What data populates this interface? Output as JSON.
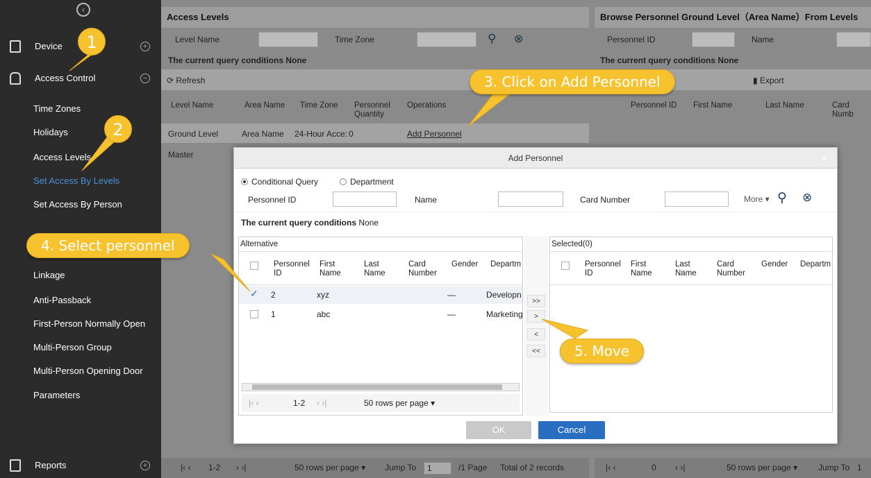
{
  "sidebar": {
    "modules": [
      {
        "label": "Device"
      },
      {
        "label": "Access Control"
      }
    ],
    "sub_items": [
      {
        "label": "Time Zones"
      },
      {
        "label": "Holidays"
      },
      {
        "label": "Access Levels"
      },
      {
        "label": "Set Access By Levels"
      },
      {
        "label": "Set Access By Person"
      },
      {
        "label": "Linkage"
      },
      {
        "label": "Anti-Passback"
      },
      {
        "label": "First-Person Normally Open"
      },
      {
        "label": "Multi-Person Group"
      },
      {
        "label": "Multi-Person Opening Door"
      },
      {
        "label": "Parameters"
      }
    ],
    "bottom_module": "Reports"
  },
  "left_panel": {
    "title": "Access Levels",
    "level_name_label": "Level Name",
    "time_zone_label": "Time Zone",
    "query_conditions": "The current query conditions None",
    "refresh_label": "Refresh",
    "columns": [
      "Level Name",
      "Area Name",
      "Time Zone",
      "Personnel Quantity",
      "Operations"
    ],
    "rows": [
      {
        "level": "Ground Level",
        "area": "Area Name",
        "tz": "24-Hour Acce:",
        "qty": "0",
        "op": "Add Personnel"
      },
      {
        "level": "Master",
        "area": "",
        "tz": "",
        "qty": "",
        "op": ""
      }
    ],
    "footer": {
      "page": "1-2",
      "rows_per_page": "50 rows per page",
      "jump_to": "Jump To",
      "jump_value": "1",
      "page_total": "/1 Page",
      "records": "Total of 2 records"
    }
  },
  "right_panel": {
    "title": "Browse Personnel Ground Level（Area Name）From Levels",
    "personnel_id_label": "Personnel ID",
    "name_label": "Name",
    "query_conditions": "The current query conditions None",
    "export_label": "Export",
    "columns": [
      "Personnel ID",
      "First Name",
      "Last Name",
      "Card Numb"
    ],
    "footer": {
      "page": "0",
      "rows_per_page": "50 rows per page",
      "jump_to": "Jump To",
      "jump_value": "1"
    }
  },
  "dialog": {
    "title": "Add Personnel",
    "close": "×",
    "mode_conditional": "Conditional Query",
    "mode_department": "Department",
    "personnel_id_label": "Personnel ID",
    "name_label": "Name",
    "card_number_label": "Card Number",
    "more_label": "More",
    "query_conditions_label": "The current query conditions",
    "query_conditions_value": "None",
    "alternative": {
      "title": "Alternative",
      "columns": [
        "Personnel ID",
        "First Name",
        "Last Name",
        "Card Number",
        "Gender",
        "Departm"
      ],
      "rows": [
        {
          "id": "2",
          "first": "xyz",
          "last": "",
          "card": "",
          "gender": "—",
          "dept": "Developn",
          "checked": true
        },
        {
          "id": "1",
          "first": "abc",
          "last": "",
          "card": "",
          "gender": "—",
          "dept": "Marketing",
          "checked": false
        }
      ],
      "pager": {
        "range": "1-2",
        "rows_per_page": "50 rows per page"
      }
    },
    "move_buttons": [
      ">>",
      ">",
      "<",
      "<<"
    ],
    "selected": {
      "title": "Selected(0)",
      "columns": [
        "Personnel ID",
        "First Name",
        "Last Name",
        "Card Number",
        "Gender",
        "Departm"
      ]
    },
    "ok_label": "OK",
    "cancel_label": "Cancel"
  },
  "callouts": {
    "step1": "1",
    "step2": "2",
    "step3": "3. Click on Add Personnel",
    "step4": "4. Select personnel",
    "step5": "5. Move"
  },
  "colors": {
    "sidebar_bg": "#2b2b2b",
    "active_link": "#4a90d9",
    "callout": "#f6c22e",
    "ok_button": "#c9c9c9",
    "cancel_button": "#2a6ec2"
  }
}
